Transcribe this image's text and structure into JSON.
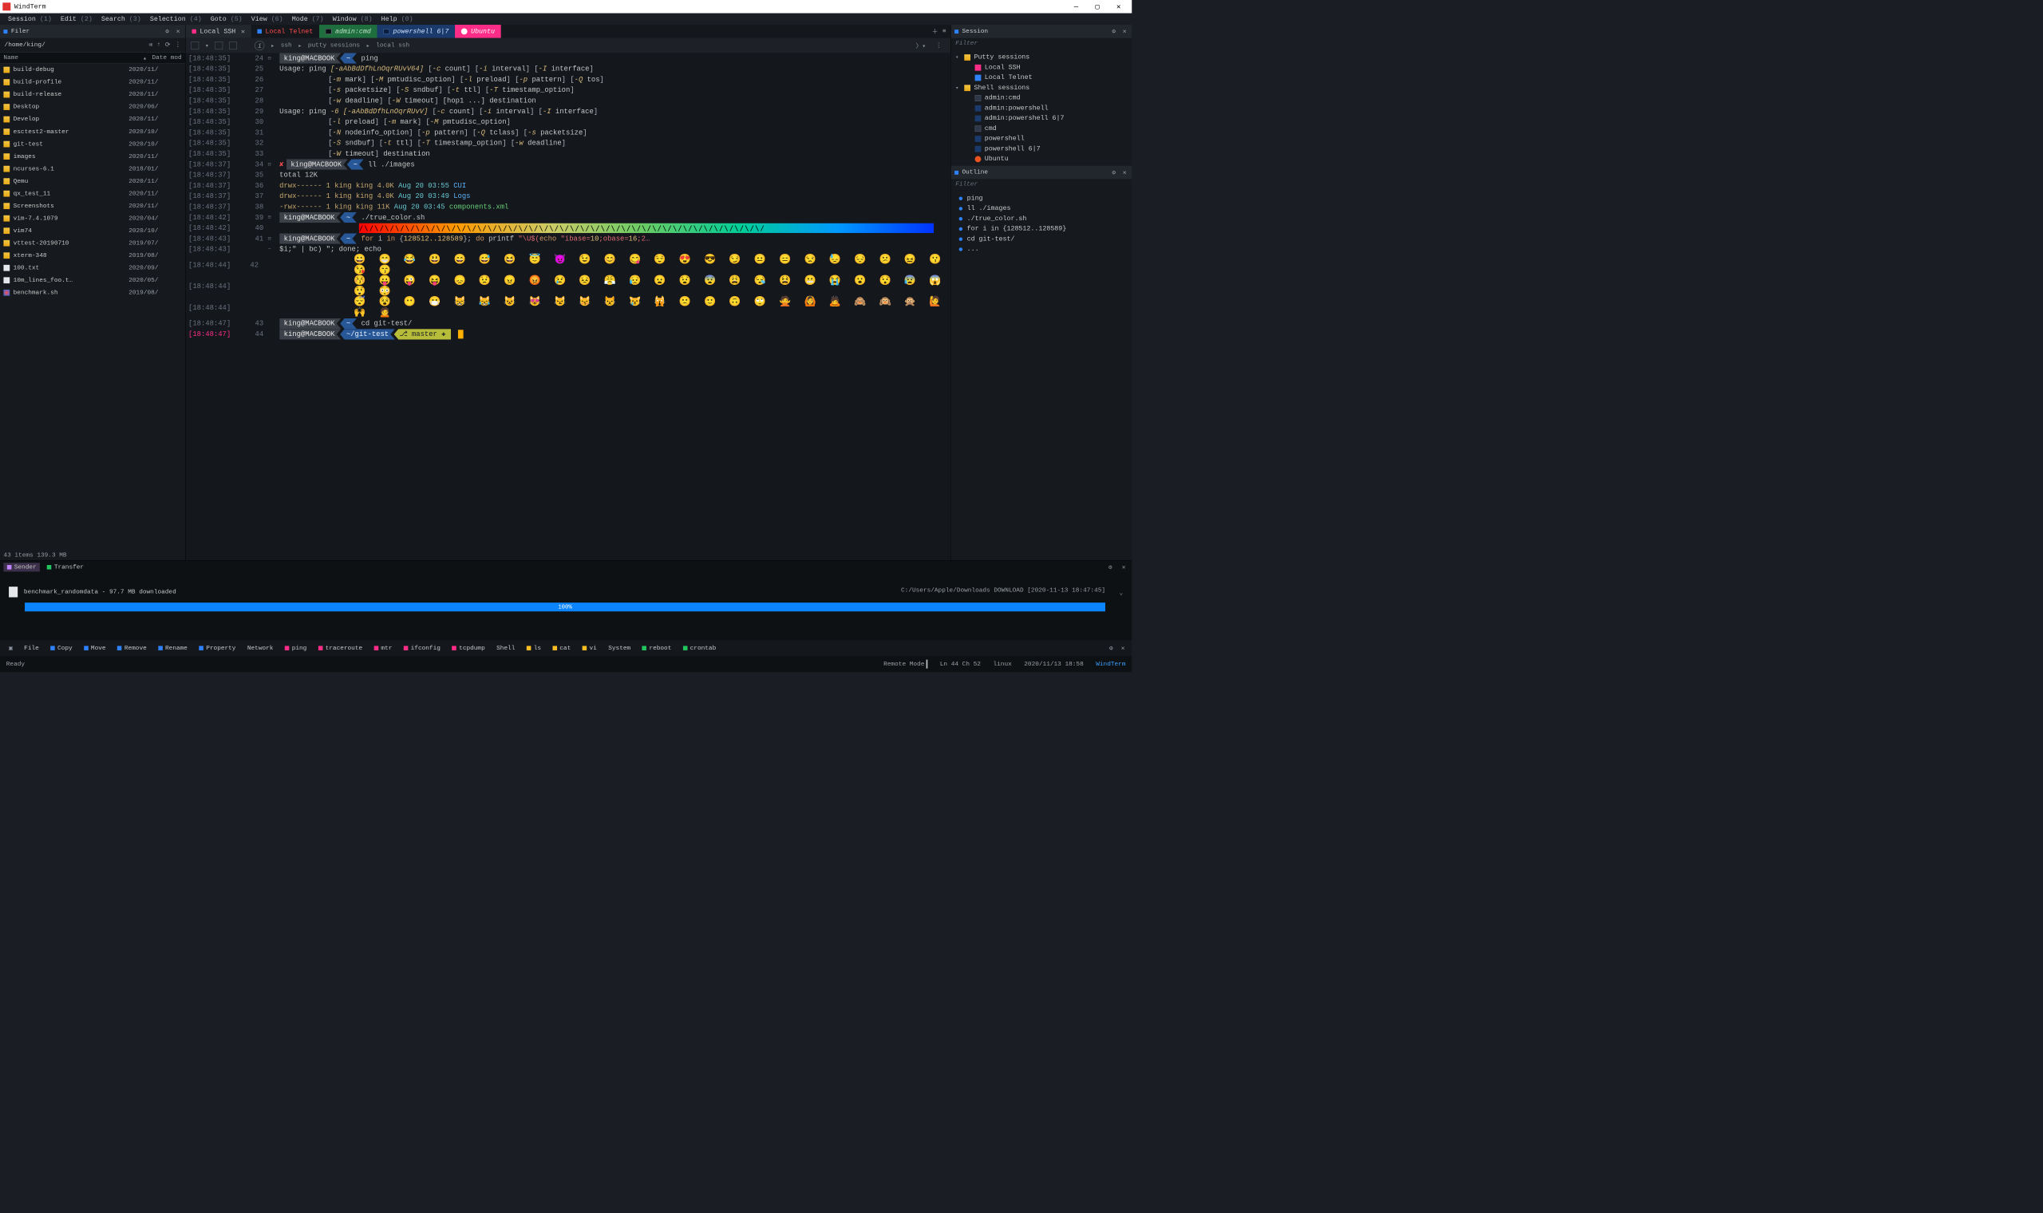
{
  "app": {
    "title": "WindTerm"
  },
  "menu": [
    {
      "label": "Session",
      "shortcut": "(1)"
    },
    {
      "label": "Edit",
      "shortcut": "(2)"
    },
    {
      "label": "Search",
      "shortcut": "(3)"
    },
    {
      "label": "Selection",
      "shortcut": "(4)"
    },
    {
      "label": "Goto",
      "shortcut": "(5)"
    },
    {
      "label": "View",
      "shortcut": "(6)"
    },
    {
      "label": "Mode",
      "shortcut": "(7)"
    },
    {
      "label": "Window",
      "shortcut": "(8)"
    },
    {
      "label": "Help",
      "shortcut": "(0)"
    }
  ],
  "filer": {
    "title": "Filer",
    "path": "/home/king/",
    "columns": {
      "name": "Name",
      "date": "Date mod"
    },
    "items": [
      {
        "name": "build-debug",
        "date": "2020/11/",
        "icon": "folder"
      },
      {
        "name": "build-profile",
        "date": "2020/11/",
        "icon": "folder"
      },
      {
        "name": "build-release",
        "date": "2020/11/",
        "icon": "folder"
      },
      {
        "name": "Desktop",
        "date": "2020/06/",
        "icon": "folder"
      },
      {
        "name": "Develop",
        "date": "2020/11/",
        "icon": "folder"
      },
      {
        "name": "esctest2-master",
        "date": "2020/10/",
        "icon": "folder"
      },
      {
        "name": "git-test",
        "date": "2020/10/",
        "icon": "folder"
      },
      {
        "name": "images",
        "date": "2020/11/",
        "icon": "folder"
      },
      {
        "name": "ncurses-6.1",
        "date": "2018/01/",
        "icon": "folder"
      },
      {
        "name": "Qemu",
        "date": "2020/11/",
        "icon": "folder"
      },
      {
        "name": "qx_test_11",
        "date": "2020/11/",
        "icon": "folder"
      },
      {
        "name": "Screenshots",
        "date": "2020/11/",
        "icon": "folder"
      },
      {
        "name": "vim-7.4.1079",
        "date": "2020/04/",
        "icon": "folder"
      },
      {
        "name": "vim74",
        "date": "2020/10/",
        "icon": "folder"
      },
      {
        "name": "vttest-20190710",
        "date": "2019/07/",
        "icon": "folder"
      },
      {
        "name": "xterm-348",
        "date": "2019/08/",
        "icon": "folder"
      },
      {
        "name": "100.txt",
        "date": "2020/09/",
        "icon": "txt"
      },
      {
        "name": "10m_lines_foo.t…",
        "date": "2020/05/",
        "icon": "txt"
      },
      {
        "name": "benchmark.sh",
        "date": "2019/08/",
        "icon": "script"
      }
    ],
    "status": "43 items 139.3 MB"
  },
  "tabs": {
    "local_ssh": "Local SSH",
    "local_telnet": "Local Telnet",
    "admin_cmd": "admin:cmd",
    "powershell67": "powershell 6|7",
    "ubuntu": "Ubuntu"
  },
  "breadcrumb": {
    "a": "ssh",
    "b": "putty sessions",
    "c": "local ssh"
  },
  "term": {
    "lines": [
      {
        "t": "[18:48:35]",
        "n": "24",
        "fold": "⊟",
        "prompt_host": "king@MACBOOK",
        "prompt_dir": "~",
        "cmd": "ping"
      },
      {
        "t": "[18:48:35]",
        "n": "25",
        "text_a": "Usage: ping ",
        "flag": "[-aAbBdDfhLnOqrRUvV64]",
        "text_b": " [-c count] [-i interval] [-I interface]"
      },
      {
        "t": "[18:48:35]",
        "n": "26",
        "text_c": "[-m mark] [-M pmtudisc_option] [-l preload] [-p pattern] [-Q tos]"
      },
      {
        "t": "[18:48:35]",
        "n": "27",
        "text_c": "[-s packetsize] [-S sndbuf] [-t ttl] [-T timestamp_option]"
      },
      {
        "t": "[18:48:35]",
        "n": "28",
        "text_c": "[-w deadline] [-W timeout] [hop1 ...] destination"
      },
      {
        "t": "[18:48:35]",
        "n": "29",
        "text_a": "Usage: ping ",
        "flag": "-6 [-aAbBdDfhLnOqrRUvV]",
        "text_b": " [-c count] [-i interval] [-I interface]"
      },
      {
        "t": "[18:48:35]",
        "n": "30",
        "text_c": "[-l preload] [-m mark] [-M pmtudisc_option]"
      },
      {
        "t": "[18:48:35]",
        "n": "31",
        "text_c": "[-N nodeinfo_option] [-p pattern] [-Q tclass] [-s packetsize]"
      },
      {
        "t": "[18:48:35]",
        "n": "32",
        "text_c": "[-S sndbuf] [-t ttl] [-T timestamp_option] [-w deadline]"
      },
      {
        "t": "[18:48:35]",
        "n": "33",
        "text_c": "[-W timeout] destination"
      },
      {
        "t": "[18:48:37]",
        "n": "34",
        "fold": "⊟",
        "fail": true,
        "prompt_host": "king@MACBOOK",
        "prompt_dir": "~",
        "cmd": "ll ./images"
      },
      {
        "t": "[18:48:37]",
        "n": "35",
        "plain": "total 12K"
      },
      {
        "t": "[18:48:37]",
        "n": "36",
        "ls": "drwx------ 1 king king 4.0K ",
        "ls_date": "Aug 20 03:55 ",
        "ls_name": "CUI",
        "ls_class": "fs-dir"
      },
      {
        "t": "[18:48:37]",
        "n": "37",
        "ls": "drwx------ 1 king king 4.0K ",
        "ls_date": "Aug 20 03:49 ",
        "ls_name": "Logs",
        "ls_class": "fs-dir"
      },
      {
        "t": "[18:48:37]",
        "n": "38",
        "ls": "-rwx------ 1 king king  11K ",
        "ls_date": "Aug 20 03:45 ",
        "ls_name": "components.xml",
        "ls_class": "fs-file"
      },
      {
        "t": "[18:48:42]",
        "n": "39",
        "fold": "⊟",
        "prompt_host": "king@MACBOOK",
        "prompt_dir": "~",
        "cmd": "./true_color.sh"
      },
      {
        "t": "[18:48:42]",
        "n": "40",
        "colorbar": "/\\/\\/\\/\\/\\/\\/\\/\\/\\/\\/\\/\\/\\/\\/\\/\\/\\/\\/\\/\\/\\/\\/\\/\\/\\/\\/\\/\\/\\/\\/\\/\\/\\/\\/\\/\\/\\/\\/\\/"
      },
      {
        "t": "[18:48:43]",
        "n": "41",
        "fold": "⊟",
        "prompt_host": "king@MACBOOK",
        "prompt_dir": "~",
        "forloop": true
      },
      {
        "t": "[18:48:43]",
        "n": "  ",
        "fold": "−",
        "plain": "$i;\" | bc) \"; done; echo"
      },
      {
        "t": "[18:48:44]",
        "n": "42",
        "emoji_row": 1
      },
      {
        "t": "[18:48:44]",
        "n": "  ",
        "emoji_row": 2
      },
      {
        "t": "[18:48:44]",
        "n": "  ",
        "emoji_row": 3
      },
      {
        "t": "[18:48:47]",
        "n": "43",
        "prompt_host": "king@MACBOOK",
        "prompt_dir": "~",
        "cmd": "cd git-test/"
      },
      {
        "t": "[18:48:47]",
        "n": "44",
        "active": true,
        "prompt_host": "king@MACBOOK",
        "prompt_dir": "~/git-test",
        "git": "⎇ master ✚",
        "cursor": true
      }
    ],
    "for_cmd": {
      "a": "for ",
      "b": "i ",
      "c": "in ",
      "d": "{",
      "e": "128512..128589",
      "f": "}; ",
      "g": "do",
      "h": " printf ",
      "i": "\"\\U$(",
      "j": "echo ",
      "k": "\"ibase=",
      "l": "10",
      "m": ";obase=",
      "n": "16",
      "o": ";2…"
    },
    "emoji": {
      "r1": "😀 😁 😂 😃 😄 😅 😆 😇 😈 😉 😊 😋 😌 😍 😎 😏 😐 😑 😒 😓 😔 😕 😖 😗 😘 😙",
      "r2": "😚 😛 😜 😝 😞 😟 😠 😡 😢 😣 😤 😥 😦 😧 😨 😩 😪 😫 😬 😭 😮 😯 😰 😱 😲 😳",
      "r3": "😴 😵 😶 😷 😸 😹 😺 😻 😼 😽 😾 😿 🙀 🙁 🙂 🙃 🙄 🙅 🙆 🙇 🙈 🙉 🙊 🙋 🙌 🙍"
    }
  },
  "session": {
    "title": "Session",
    "filter": "Filter",
    "groups": [
      {
        "label": "Putty sessions",
        "items": [
          {
            "label": "Local SSH",
            "icon": "pink-dot"
          },
          {
            "label": "Local Telnet",
            "icon": "blue-sq"
          }
        ]
      },
      {
        "label": "Shell sessions",
        "items": [
          {
            "label": "admin:cmd",
            "icon": "cmd"
          },
          {
            "label": "admin:powershell",
            "icon": "ps"
          },
          {
            "label": "admin:powershell 6|7",
            "icon": "ps"
          },
          {
            "label": "cmd",
            "icon": "cmd"
          },
          {
            "label": "powershell",
            "icon": "ps"
          },
          {
            "label": "powershell 6|7",
            "icon": "ps"
          },
          {
            "label": "Ubuntu",
            "icon": "ubuntu"
          }
        ]
      }
    ]
  },
  "outline": {
    "title": "Outline",
    "filter": "Filter",
    "items": [
      "ping",
      "ll ./images",
      "./true_color.sh",
      "for i in {128512..128589}",
      "cd git-test/",
      "..."
    ]
  },
  "transfer": {
    "sender_label": "Sender",
    "transfer_label": "Transfer",
    "file_label": "benchmark_randomdata - 97.7 MB downloaded",
    "meta": "C:/Users/Apple/Downloads DOWNLOAD [2020-11-13 18:47:45]",
    "progress": "100%"
  },
  "actionbar": [
    {
      "label": "",
      "icon": "▣",
      "color": ""
    },
    {
      "label": "File",
      "color": ""
    },
    {
      "label": "Copy",
      "color": "#2f81f7"
    },
    {
      "label": "Move",
      "color": "#2f81f7"
    },
    {
      "label": "Remove",
      "color": "#2f81f7"
    },
    {
      "label": "Rename",
      "color": "#2f81f7"
    },
    {
      "label": "Property",
      "color": "#2f81f7"
    },
    {
      "label": "Network",
      "color": ""
    },
    {
      "label": "ping",
      "color": "#ff2d87"
    },
    {
      "label": "traceroute",
      "color": "#ff2d87"
    },
    {
      "label": "mtr",
      "color": "#ff2d87"
    },
    {
      "label": "ifconfig",
      "color": "#ff2d87"
    },
    {
      "label": "tcpdump",
      "color": "#ff2d87"
    },
    {
      "label": "Shell",
      "color": ""
    },
    {
      "label": "ls",
      "color": "#fbbf24"
    },
    {
      "label": "cat",
      "color": "#fbbf24"
    },
    {
      "label": "vi",
      "color": "#fbbf24"
    },
    {
      "label": "System",
      "color": ""
    },
    {
      "label": "reboot",
      "color": "#22c55e"
    },
    {
      "label": "crontab",
      "color": "#22c55e"
    }
  ],
  "status": {
    "ready": "Ready",
    "mode": "Remote Mode",
    "lncol": "Ln 44 Ch 52",
    "os": "linux",
    "datetime": "2020/11/13 18:58",
    "brand": "WindTerm"
  }
}
